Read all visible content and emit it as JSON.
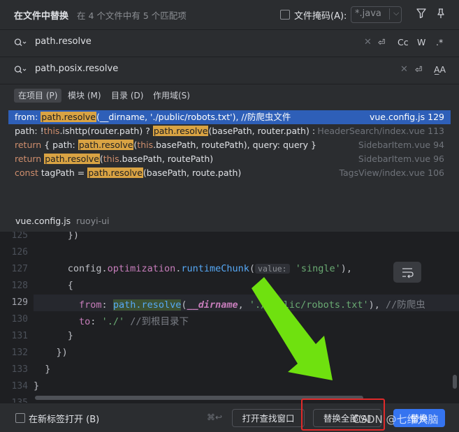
{
  "header": {
    "title": "在文件中替换",
    "subtitle": "在 4 个文件中有 5 个匹配项",
    "file_mask_label": "文件掩码(A):",
    "file_mask_value": "*.java",
    "chevron": "⌵"
  },
  "find": {
    "value": "path.resolve",
    "clear": "✕",
    "option_icons": [
      "⏎",
      "Cc",
      "W",
      ".*"
    ]
  },
  "replace": {
    "value": "path.posix.resolve",
    "clear": "✕",
    "option_icons": [
      "⏎",
      "A̲A"
    ]
  },
  "scope_tabs": [
    {
      "label": "在项目 (P)",
      "active": true
    },
    {
      "label": "模块 (M)",
      "active": false
    },
    {
      "label": "目录 (D)",
      "active": false
    },
    {
      "label": "作用域(S)",
      "active": false
    }
  ],
  "results": [
    {
      "pre": "from: ",
      "match": "path.resolve",
      "post": "(__dirname, './public/robots.txt'), //防爬虫文件",
      "file": "vue.config.js 129",
      "selected": true
    },
    {
      "pre": "path: !",
      "kw_pre": "this",
      "pre2": ".ishttp(router.path) ? ",
      "match": "path.resolve",
      "post": "(basePath, router.path) : ",
      "file": "HeaderSearch/index.vue 113",
      "selected": false
    },
    {
      "kw": "return",
      "pre": " { path: ",
      "match": "path.resolve",
      "post_kw": "this",
      "post": ".basePath, routePath), query: query }",
      "file": "SidebarItem.vue 94",
      "selected": false
    },
    {
      "kw": "return",
      "pre": " ",
      "match": "path.resolve",
      "post_kw": "this",
      "post": ".basePath, routePath)",
      "file": "SidebarItem.vue 96",
      "selected": false
    },
    {
      "kw": "const",
      "pre": " tagPath = ",
      "match": "path.resolve",
      "post": "(basePath, route.path)",
      "file": "TagsView/index.vue 106",
      "selected": false
    }
  ],
  "preview": {
    "file_name": "vue.config.js",
    "project": "ruoyi-ui",
    "line_numbers": [
      "125",
      "126",
      "127",
      "128",
      "129",
      "130",
      "131",
      "132",
      "133",
      "134",
      "135"
    ],
    "current_line": "129",
    "code": {
      "l125": "      })",
      "l127_pre": "      config.",
      "l127_prop": "optimization",
      "l127_dot": ".",
      "l127_method": "runtimeChunk",
      "l127_paren": "(",
      "l127_hint": "value:",
      "l127_str": "'single'",
      "l127_close": "),",
      "l128": "      {",
      "l129_pre": "        ",
      "l129_prop": "from",
      "l129_colon": ": ",
      "l129_match": "path.resolve",
      "l129_open": "(",
      "l129_dirname": "__dirname",
      "l129_comma": ", ",
      "l129_str": "'./public/robots.txt'",
      "l129_close": "), ",
      "l129_comment": "//防爬虫",
      "l130_pre": "        ",
      "l130_prop": "to",
      "l130_colon": ": ",
      "l130_str": "'./'",
      "l130_comment": " //到根目录下",
      "l131": "      }",
      "l132": "    })",
      "l133": "  }",
      "l134": "}"
    }
  },
  "footer": {
    "open_new_tab_label": "在新标签打开 (B)",
    "shortcut": "⌘↩",
    "open_find_window_label": "打开查找窗口",
    "replace_all_label": "替换全部(A)",
    "replace_label": "替换"
  },
  "watermark": "CSDN @七维大脑",
  "colors": {
    "arrow": "#6fe10f",
    "highlight_box": "#e02a2a",
    "selection": "#2e5fb8",
    "match_bg": "#d9a343"
  }
}
